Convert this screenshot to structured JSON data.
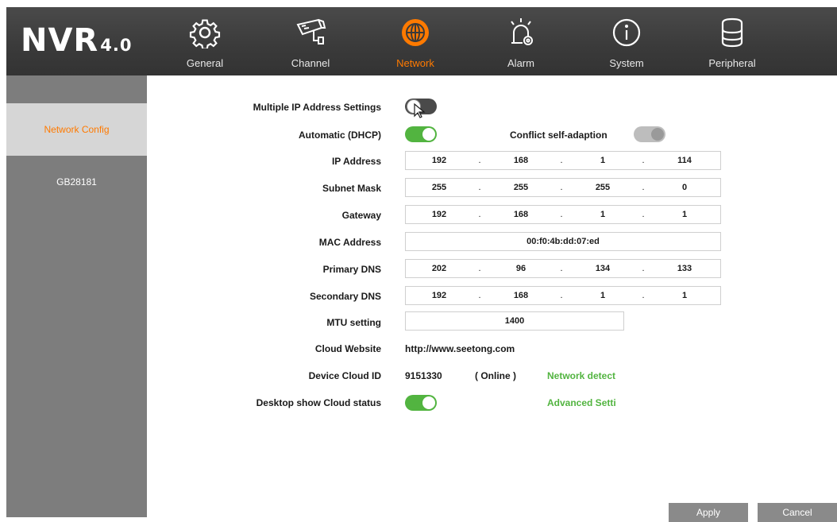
{
  "brand": {
    "name": "NVR",
    "version": "4.0"
  },
  "nav": [
    {
      "label": "General",
      "icon": "gear-icon"
    },
    {
      "label": "Channel",
      "icon": "camera-icon"
    },
    {
      "label": "Network",
      "icon": "globe-icon",
      "active": true
    },
    {
      "label": "Alarm",
      "icon": "alarm-icon"
    },
    {
      "label": "System",
      "icon": "info-icon"
    },
    {
      "label": "Peripheral",
      "icon": "database-icon"
    }
  ],
  "sidebar": {
    "items": [
      {
        "label": "Network Config",
        "active": true
      },
      {
        "label": "GB28181"
      }
    ]
  },
  "form": {
    "multiple_ip_label": "Multiple IP Address Settings",
    "multiple_ip_on": false,
    "dhcp_label": "Automatic (DHCP)",
    "dhcp_on": true,
    "conflict_label": "Conflict self-adaption",
    "conflict_on": false,
    "ip_label": "IP Address",
    "ip": [
      "192",
      "168",
      "1",
      "114"
    ],
    "subnet_label": "Subnet Mask",
    "subnet": [
      "255",
      "255",
      "255",
      "0"
    ],
    "gateway_label": "Gateway",
    "gateway": [
      "192",
      "168",
      "1",
      "1"
    ],
    "mac_label": "MAC Address",
    "mac": "00:f0:4b:dd:07:ed",
    "primary_dns_label": "Primary DNS",
    "primary_dns": [
      "202",
      "96",
      "134",
      "133"
    ],
    "secondary_dns_label": "Secondary DNS",
    "secondary_dns": [
      "192",
      "168",
      "1",
      "1"
    ],
    "mtu_label": "MTU setting",
    "mtu": "1400",
    "cloud_website_label": "Cloud Website",
    "cloud_website": "http://www.seetong.com",
    "device_cloud_id_label": "Device Cloud ID",
    "device_cloud_id": "9151330",
    "cloud_status": "( Online )",
    "network_detect": "Network detect",
    "desktop_cloud_label": "Desktop show Cloud status",
    "desktop_cloud_on": true,
    "advanced_settings": "Advanced Setti"
  },
  "buttons": {
    "apply": "Apply",
    "cancel": "Cancel"
  },
  "colors": {
    "accent": "#ff7a00",
    "toggle_on": "#52b440",
    "sidebar": "#7d7d7d",
    "header": "#3a3a3a"
  }
}
